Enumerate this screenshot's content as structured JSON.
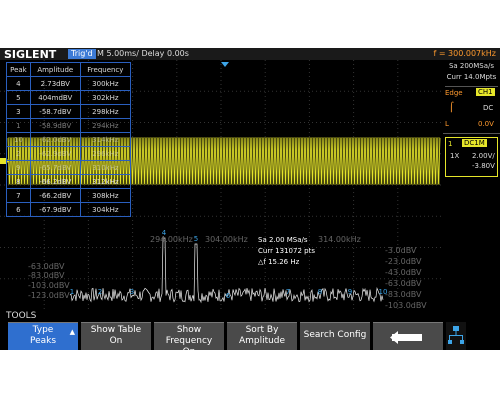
{
  "header": {
    "brand": "SIGLENT",
    "trigger_state": "Trig'd",
    "timebase": "M 5.00ms/ Delay 0.00s",
    "frequency": "f = 300.007kHz"
  },
  "right_panel": {
    "sample_rate": "Sa 200MSa/s",
    "curr_pts": "Curr 14.0Mpts",
    "trigger_type": "Edge",
    "trigger_source": "CH1",
    "coupling": "DC",
    "level_label": "L",
    "level_value": "0.0V",
    "ch_number": "1",
    "ch_coupling": "DC1M",
    "probe": "1X",
    "volts_div": "2.00V/",
    "offset": "-3.80V"
  },
  "peak_table": {
    "headers": [
      "Peak",
      "Amplitude",
      "Frequency"
    ],
    "rows": [
      [
        "4",
        "2.73dBV",
        "300kHz"
      ],
      [
        "5",
        "404mdBV",
        "302kHz"
      ],
      [
        "3",
        "-58.7dBV",
        "298kHz"
      ],
      [
        "1",
        "-58.9dBV",
        "294kHz"
      ],
      [
        "10",
        "-62.0dBV",
        "314kHz"
      ],
      [
        "2",
        "-62.9dBV",
        "296kHz"
      ],
      [
        "9",
        "-65.7dBV",
        "310kHz"
      ],
      [
        "8",
        "-66.2dBV",
        "312kHz"
      ],
      [
        "7",
        "-66.2dBV",
        "308kHz"
      ],
      [
        "6",
        "-67.9dBV",
        "304kHz"
      ]
    ]
  },
  "fft_info": {
    "sa": "Sa 2.00 MSa/s",
    "curr": "Curr 131072 pts",
    "delta_f": "△f 15.26 Hz",
    "freq_left_dim": "294.00kHz",
    "freq_center": "304.00kHz",
    "freq_right": "314.00kHz",
    "db_left": [
      "-63.0dBV",
      "-83.0dBV",
      "-103.0dBV",
      "-123.0dBV"
    ],
    "db_right": [
      "-3.0dBV",
      "-23.0dBV",
      "-43.0dBV",
      "-63.0dBV",
      "-83.0dBV",
      "-103.0dBV",
      "-123.0dBV"
    ],
    "marker_labels": [
      "1",
      "2",
      "3",
      "4",
      "5",
      "6",
      "7",
      "8",
      "9",
      "10"
    ]
  },
  "tools_label": "TOOLS",
  "softkeys": {
    "type_line1": "Type",
    "type_line2": "Peaks",
    "show_table_line1": "Show Table",
    "show_table_line2": "On",
    "show_freq_line1": "Show Frequency",
    "show_freq_line2": "On",
    "sort_line1": "Sort By",
    "sort_line2": "Amplitude",
    "search_config": "Search Config"
  },
  "colors": {
    "trace": "#e6e62a",
    "table_border": "#2a5fbf",
    "accent_orange": "#ff9a2e",
    "softkey_blue": "#2f6fcf"
  },
  "icons": {
    "back": "return-arrow-icon",
    "network": "network-icon"
  }
}
